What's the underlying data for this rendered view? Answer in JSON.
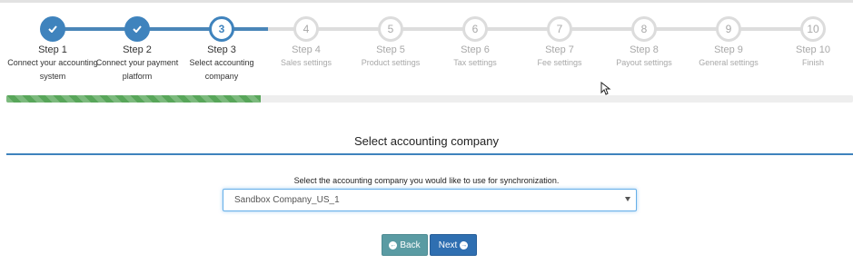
{
  "wizard": {
    "steps": [
      {
        "number": "1",
        "label": "Step 1",
        "desc_line1": "Connect your accounting",
        "desc_line2": "system",
        "state": "complete"
      },
      {
        "number": "2",
        "label": "Step 2",
        "desc_line1": "Connect your payment",
        "desc_line2": "platform",
        "state": "complete"
      },
      {
        "number": "3",
        "label": "Step 3",
        "desc_line1": "Select accounting",
        "desc_line2": "company",
        "state": "current"
      },
      {
        "number": "4",
        "label": "Step 4",
        "desc_line1": "Sales settings",
        "desc_line2": "",
        "state": "pending"
      },
      {
        "number": "5",
        "label": "Step 5",
        "desc_line1": "Product settings",
        "desc_line2": "",
        "state": "pending"
      },
      {
        "number": "6",
        "label": "Step 6",
        "desc_line1": "Tax settings",
        "desc_line2": "",
        "state": "pending"
      },
      {
        "number": "7",
        "label": "Step 7",
        "desc_line1": "Fee settings",
        "desc_line2": "",
        "state": "pending"
      },
      {
        "number": "8",
        "label": "Step 8",
        "desc_line1": "Payout settings",
        "desc_line2": "",
        "state": "pending"
      },
      {
        "number": "9",
        "label": "Step 9",
        "desc_line1": "General settings",
        "desc_line2": "",
        "state": "pending"
      },
      {
        "number": "10",
        "label": "Step 10",
        "desc_line1": "Finish",
        "desc_line2": "",
        "state": "pending"
      }
    ],
    "progress_percent": 30
  },
  "section": {
    "title": "Select accounting company",
    "instruction": "Select the accounting company you would like to use for synchronization."
  },
  "company_select": {
    "selected": "Sandbox Company_US_1"
  },
  "actions": {
    "back_label": "Back",
    "next_label": "Next"
  },
  "colors": {
    "accent": "#3f83bd",
    "progress": "#58a65a",
    "back_button": "#5a9ba3",
    "next_button": "#2f6fb1"
  },
  "icons": {
    "complete_step": "check-icon",
    "back": "circle-arrow-left-icon",
    "next": "circle-arrow-right-icon",
    "select": "caret-down-icon"
  }
}
